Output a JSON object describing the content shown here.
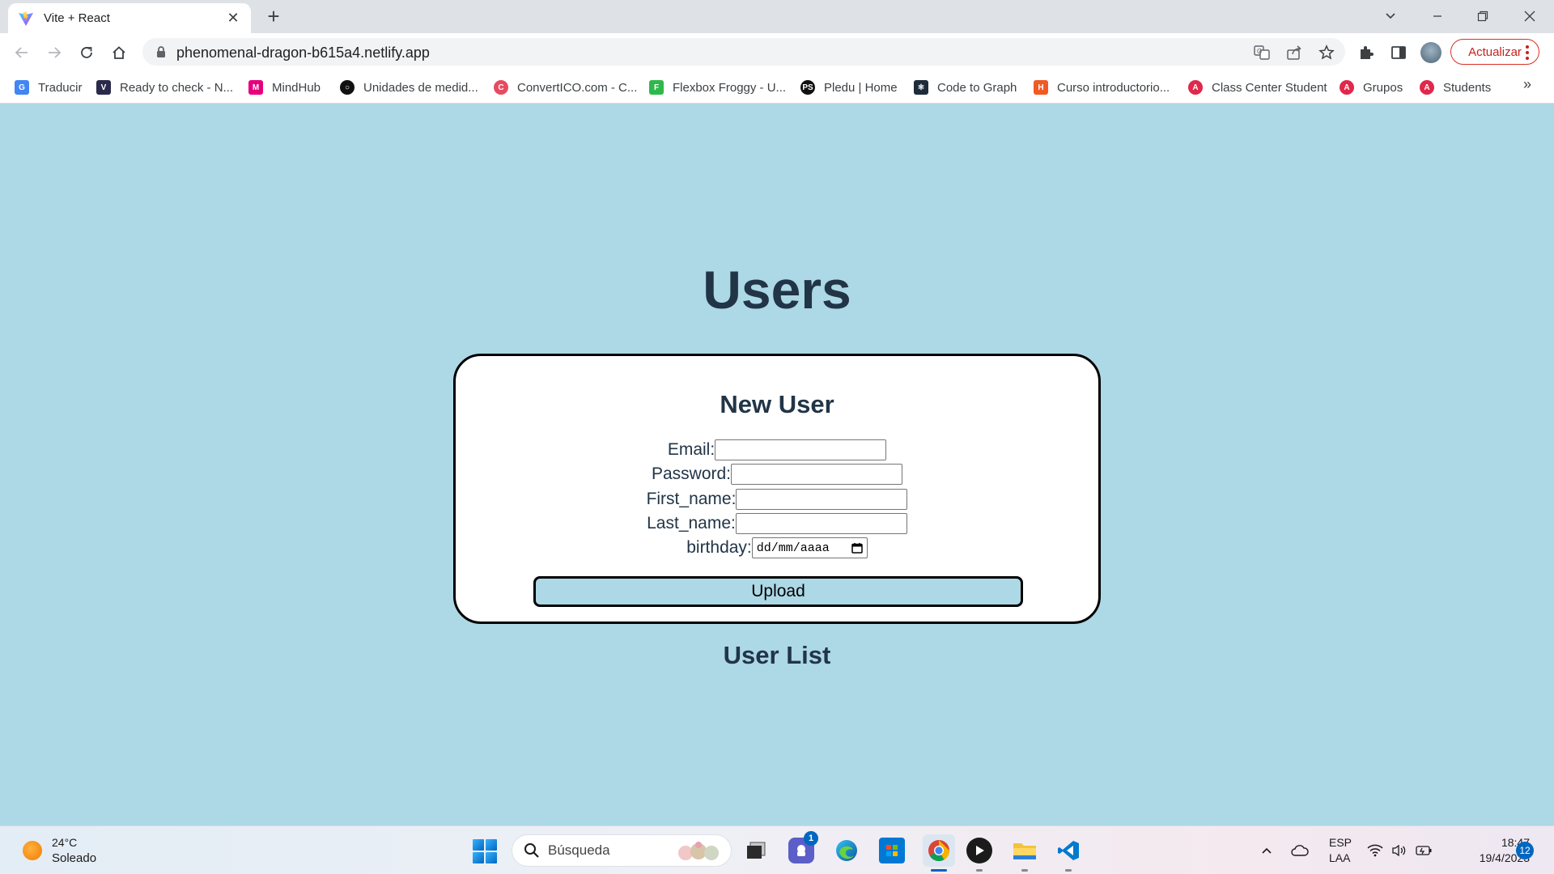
{
  "browser": {
    "tab_title": "Vite + React",
    "new_tab_symbol": "+",
    "url": "phenomenal-dragon-b615a4.netlify.app",
    "update_label": "Actualizar",
    "bookmarks": [
      {
        "label": "Traducir",
        "icon": "translate-icon",
        "color": "#4285f4"
      },
      {
        "label": "Ready to check - N...",
        "icon": "ready-to-check-icon",
        "color": "#2a2a4a"
      },
      {
        "label": "MindHub",
        "icon": "mindhub-icon",
        "color": "#e6007e"
      },
      {
        "label": "Unidades de medid...",
        "icon": "unidades-icon",
        "color": "#111111"
      },
      {
        "label": "ConvertICO.com - C...",
        "icon": "convertico-icon",
        "color": "#e84a5f"
      },
      {
        "label": "Flexbox Froggy - U...",
        "icon": "froggy-icon",
        "color": "#2fb84a"
      },
      {
        "label": "Pledu | Home",
        "icon": "pledu-icon",
        "color": "#111111"
      },
      {
        "label": "Code to Graph",
        "icon": "code-to-graph-icon",
        "color": "#1d2b3a"
      },
      {
        "label": "Curso introductorio...",
        "icon": "curso-icon",
        "color": "#f15a24"
      },
      {
        "label": "Class Center Student",
        "icon": "class-center-icon",
        "color": "#e0284a"
      },
      {
        "label": "Grupos",
        "icon": "grupos-icon",
        "color": "#e0284a"
      },
      {
        "label": "Students",
        "icon": "students-icon",
        "color": "#e0284a"
      }
    ],
    "bookmarks_more": "»"
  },
  "page": {
    "title": "Users",
    "form": {
      "title": "New User",
      "email_label": "Email:",
      "email_value": "",
      "password_label": "Password:",
      "password_value": "",
      "first_name_label": "First_name:",
      "first_name_value": "",
      "last_name_label": "Last_name:",
      "last_name_value": "",
      "birthday_label": "birthday:",
      "birthday_placeholder": "dd/mm/aaaa",
      "upload_label": "Upload"
    },
    "user_list_title": "User List",
    "colors": {
      "background": "#add8e6",
      "heading": "#213547",
      "card": "#ffffff",
      "border": "#000000"
    }
  },
  "taskbar": {
    "weather_temp": "24°C",
    "weather_desc": "Soleado",
    "search_label": "Búsqueda",
    "teams_badge": "1",
    "lang_top": "ESP",
    "lang_bottom": "LAA",
    "time": "18:47",
    "date": "19/4/2023",
    "notifications": "12",
    "apps": [
      "file-explorer-stack",
      "teams",
      "edge",
      "microsoft-store",
      "chrome",
      "media-player",
      "file-explorer",
      "vscode"
    ]
  }
}
